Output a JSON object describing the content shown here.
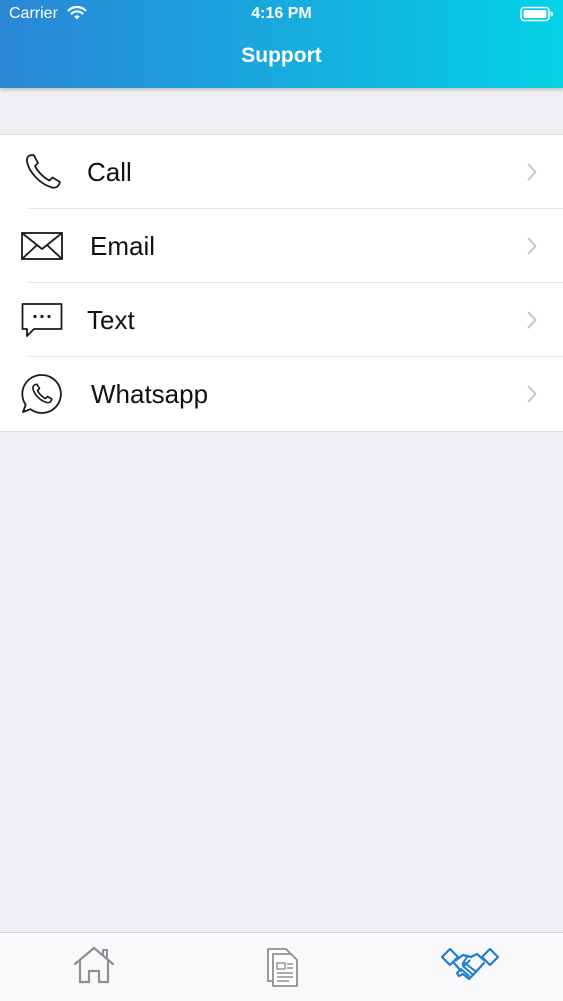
{
  "status_bar": {
    "carrier": "Carrier",
    "time": "4:16 PM"
  },
  "header": {
    "title": "Support"
  },
  "support_options": [
    {
      "label": "Call",
      "icon": "phone-icon"
    },
    {
      "label": "Email",
      "icon": "envelope-icon"
    },
    {
      "label": "Text",
      "icon": "message-bubble-icon"
    },
    {
      "label": "Whatsapp",
      "icon": "whatsapp-icon"
    }
  ],
  "tab_bar": {
    "tabs": [
      {
        "icon": "home-icon",
        "selected": false
      },
      {
        "icon": "documents-icon",
        "selected": false
      },
      {
        "icon": "handshake-icon",
        "selected": true
      }
    ]
  },
  "colors": {
    "header_gradient_start": "#2b86d6",
    "header_gradient_end": "#05d2e6",
    "active_tab": "#1e7fd0",
    "inactive_tab": "#8e8e93",
    "background": "#efeff4"
  }
}
